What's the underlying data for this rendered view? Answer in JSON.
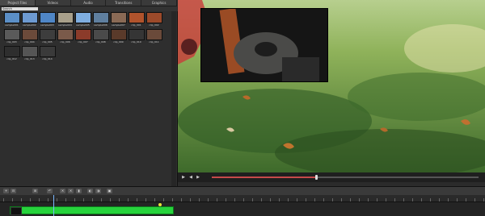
{
  "library": {
    "tabs": [
      "Project Files",
      "Videos",
      "Audio",
      "Transitions",
      "Graphics"
    ],
    "search_placeholder": "Search",
    "items": [
      {
        "label": "sample001",
        "color": "#5b8fc7"
      },
      {
        "label": "sample002",
        "color": "#6d9ad1"
      },
      {
        "label": "sample003",
        "color": "#4f86c6"
      },
      {
        "label": "sample004",
        "color": "#a89f8a"
      },
      {
        "label": "sample005",
        "color": "#7faee0"
      },
      {
        "label": "sample006",
        "color": "#5f7f9f"
      },
      {
        "label": "sample007",
        "color": "#8a6a55"
      },
      {
        "label": "clip_001",
        "color": "#b0532c"
      },
      {
        "label": "clip_002",
        "color": "#9c4a2a"
      },
      {
        "label": "clip_003",
        "color": "#5a5a5a"
      },
      {
        "label": "clip_004",
        "color": "#6b4a3a"
      },
      {
        "label": "clip_005",
        "color": "#3d3d3d"
      },
      {
        "label": "clip_006",
        "color": "#7a5a4a"
      },
      {
        "label": "clip_007",
        "color": "#8b3b2a"
      },
      {
        "label": "clip_008",
        "color": "#4a4a4a"
      },
      {
        "label": "clip_009",
        "color": "#5a3a2a"
      },
      {
        "label": "clip_010",
        "color": "#353535"
      },
      {
        "label": "clip_011",
        "color": "#6a4a3a"
      },
      {
        "label": "clip_012",
        "color": "#2e2e2e"
      },
      {
        "label": "clip_013",
        "color": "#555555"
      },
      {
        "label": "clip_014",
        "color": "#3a3a3a"
      }
    ]
  },
  "playback": {
    "progress": 0.39,
    "controls": [
      "play",
      "prev-frame",
      "next-frame"
    ]
  },
  "timeline": {
    "clip_color": "#27d33c"
  }
}
